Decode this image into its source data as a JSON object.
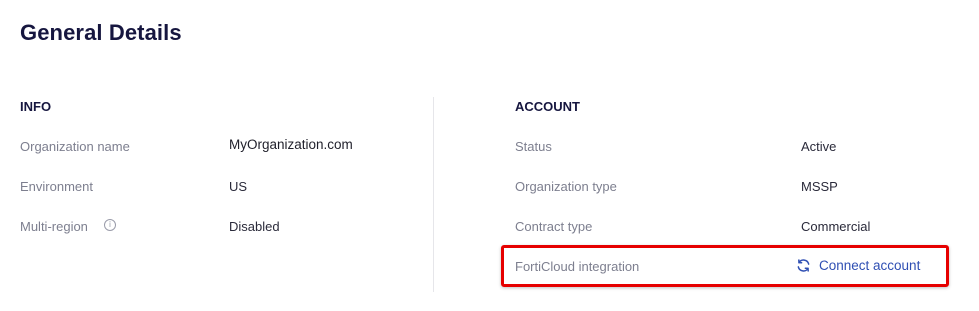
{
  "page": {
    "title": "General Details"
  },
  "info": {
    "heading": "INFO",
    "rows": [
      {
        "label": "Organization name",
        "value": "MyOrganization.com"
      },
      {
        "label": "Environment",
        "value": "US"
      },
      {
        "label": "Multi-region",
        "value": "Disabled",
        "icon": "info-icon"
      }
    ]
  },
  "account": {
    "heading": "ACCOUNT",
    "rows": [
      {
        "label": "Status",
        "value": "Active"
      },
      {
        "label": "Organization type",
        "value": "MSSP"
      },
      {
        "label": "Contract type",
        "value": "Commercial"
      },
      {
        "label": "FortiCloud integration",
        "action_label": "Connect account",
        "action_icon": "sync-icon"
      }
    ]
  },
  "colors": {
    "heading": "#16163f",
    "label": "#7d7f8f",
    "link": "#2f4fb3",
    "highlight": "#e60000"
  }
}
